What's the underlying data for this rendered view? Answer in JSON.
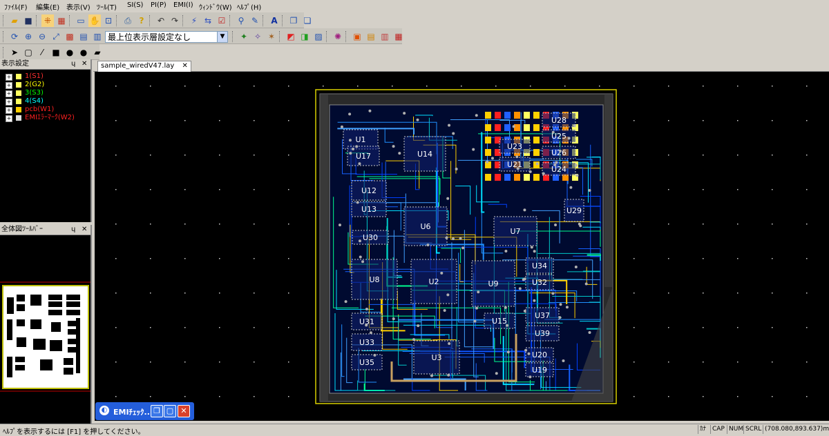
{
  "menu": [
    "ﾌｧｲﾙ(F)",
    "編集(E)",
    "表示(V)",
    "ﾂｰﾙ(T)",
    "SI(S)",
    "PI(P)",
    "EMI(I)",
    "ｳｨﾝﾄﾞｳ(W)",
    "ﾍﾙﾌﾟ(H)"
  ],
  "toolbar": {
    "layer_select": "最上位表示層設定なし"
  },
  "display_panel": {
    "title": "表示設定",
    "pin": "ɥ",
    "close": "✕",
    "layers": [
      {
        "label": "1(S1)",
        "color": "#ff3030"
      },
      {
        "label": "2(G2)",
        "color": "#ffff00"
      },
      {
        "label": "3(S3)",
        "color": "#00ff00"
      },
      {
        "label": "4(S4)",
        "color": "#00ffff"
      },
      {
        "label": "pcb(W1)",
        "color": "#ff2020"
      },
      {
        "label": "EMIｴﾗｰﾏｰｸ(W2)",
        "color": "#ff2020"
      }
    ]
  },
  "overview_panel": {
    "title": "全体図ﾂｰﾙﾊﾞｰ",
    "pin": "ɥ",
    "close": "✕"
  },
  "document_tab": {
    "label": "sample_wiredV47.lay",
    "close": "✕"
  },
  "components": [
    "U1",
    "U14",
    "U17",
    "U12",
    "U13",
    "U6",
    "U7",
    "U29",
    "U30",
    "U8",
    "U2",
    "U9",
    "U34",
    "U32",
    "U37",
    "U15",
    "U31",
    "U33",
    "U39",
    "U3",
    "U20",
    "U35",
    "U19",
    "U28",
    "U25",
    "U23",
    "U26",
    "U21",
    "U24"
  ],
  "task_window": {
    "title": "EMIﾁｪｯｸ..."
  },
  "statusbar": {
    "help_text": "ﾍﾙﾌﾟを表示するには [F1] を押してください。",
    "kana": "ｶﾅ",
    "cap": "CAP",
    "num": "NUM",
    "scrl": "SCRL",
    "coords": "(708.080,893.637)mm"
  }
}
